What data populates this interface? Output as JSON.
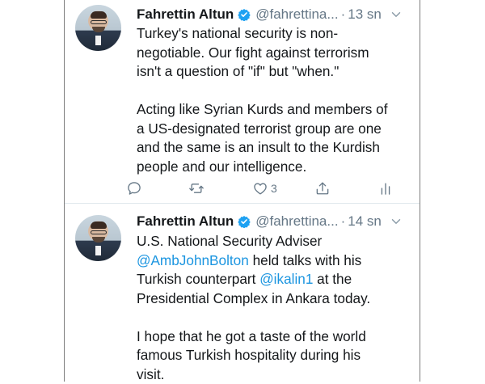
{
  "tweets": [
    {
      "author_name": "Fahrettin Altun",
      "handle": "@fahrettina...",
      "separator": "·",
      "time": "13 sn",
      "body_lines_p1": [
        "Turkey's national security is non-",
        "negotiable. Our fight against terrorism",
        "isn't a question of \"if\" but \"when.\""
      ],
      "body_lines_p2": [
        "Acting like Syrian Kurds and members of",
        "a US-designated terrorist group are one",
        "and the same is an insult to the Kurdish",
        "people and our intelligence."
      ],
      "actions": {
        "like_count": "3"
      }
    },
    {
      "author_name": "Fahrettin Altun",
      "handle": "@fahrettina...",
      "separator": "·",
      "time": "14 sn",
      "line1": "U.S. National Security Adviser",
      "mention1": "@AmbJohnBolton",
      "line2_rest": " held talks with his",
      "line3_start": "Turkish counterpart ",
      "mention2": "@ikalin1",
      "line3_rest": " at the",
      "line4": "Presidential Complex in Ankara today.",
      "body_lines_p2": [
        "I hope that he got a taste of the world",
        "famous Turkish hospitality during his",
        "visit."
      ]
    }
  ],
  "colors": {
    "text": "#14171a",
    "muted": "#657786",
    "link": "#1b95e0",
    "verified": "#1da1f2"
  },
  "icons": [
    "verified-badge-icon",
    "chevron-down-icon",
    "reply-icon",
    "retweet-icon",
    "like-icon",
    "share-icon",
    "analytics-icon"
  ]
}
